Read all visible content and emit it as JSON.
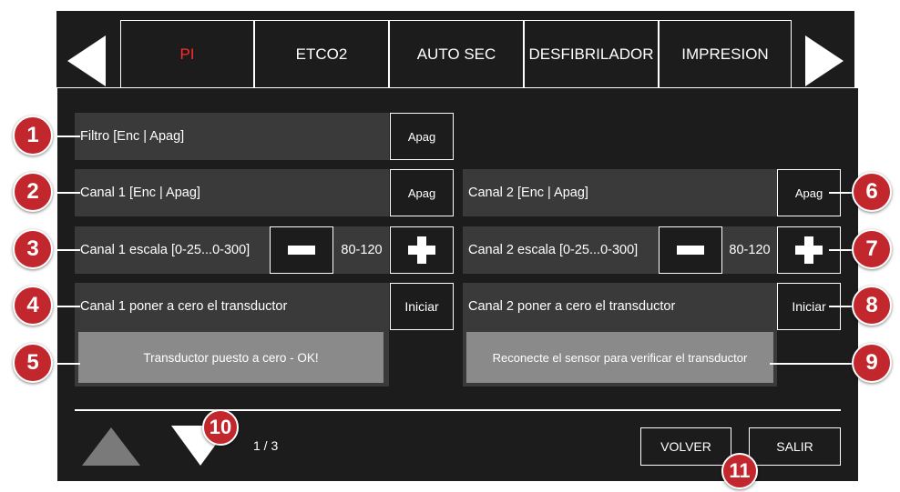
{
  "tabs": [
    {
      "label": "PI"
    },
    {
      "label": "ETCO2"
    },
    {
      "label": "AUTO SEC"
    },
    {
      "label": "DESFIBRILADOR"
    },
    {
      "label": "IMPRESION"
    }
  ],
  "rows": {
    "filtro": {
      "label": "Filtro [Enc | Apag]",
      "value": "Apag"
    },
    "canal1": {
      "label": "Canal 1 [Enc | Apag]",
      "value": "Apag"
    },
    "canal2": {
      "label": "Canal 2 [Enc | Apag]",
      "value": "Apag"
    },
    "canal1_escala": {
      "label": "Canal 1 escala [0-25...0-300]",
      "value": "80-120"
    },
    "canal2_escala": {
      "label": "Canal 2 escala [0-25...0-300]",
      "value": "80-120"
    },
    "canal1_cero": {
      "label": "Canal 1 poner a cero el transductor",
      "button": "Iniciar",
      "status": "Transductor puesto a cero - OK!"
    },
    "canal2_cero": {
      "label": "Canal 2 poner a cero el transductor",
      "button": "Iniciar",
      "status": "Reconecte el sensor para verificar el transductor"
    }
  },
  "footer": {
    "page": "1 / 3",
    "volver": "VOLVER",
    "salir": "SALIR"
  },
  "callouts": [
    "1",
    "2",
    "3",
    "4",
    "5",
    "6",
    "7",
    "8",
    "9",
    "10",
    "11"
  ],
  "colors": {
    "background": "#1c1c1c",
    "row": "#3a3a3a",
    "status": "#8a8a8a",
    "active_tab": "#ff2a2a",
    "callout": "#c1272d"
  }
}
